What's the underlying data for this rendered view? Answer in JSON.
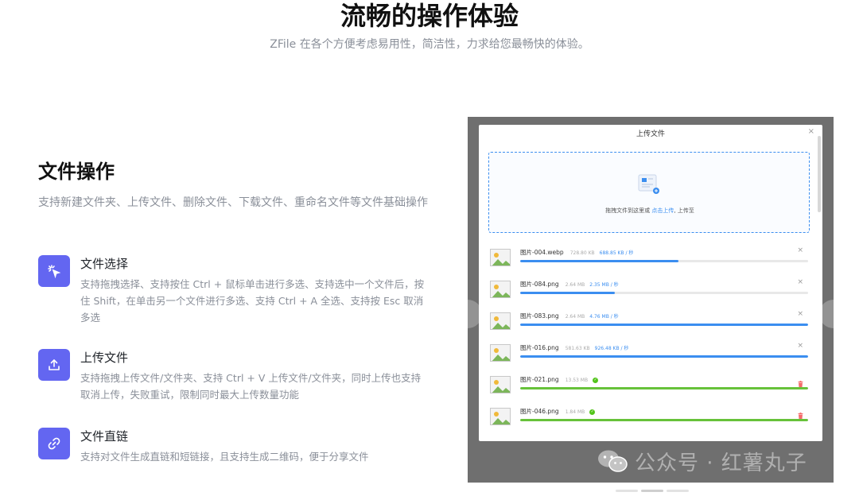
{
  "hero": {
    "title": "流畅的操作体验",
    "subtitle": "ZFile 在各个方便考虑易用性，简洁性，力求给您最畅快的体验。"
  },
  "section": {
    "title": "文件操作",
    "description": "支持新建文件夹、上传文件、删除文件、下载文件、重命名文件等文件基础操作"
  },
  "features": [
    {
      "icon": "cursor-click-icon",
      "title": "文件选择",
      "description": "支持拖拽选择、支持按住 Ctrl + 鼠标单击进行多选、支持选中一个文件后，按住 Shift，在单击另一个文件进行多选、支持 Ctrl + A 全选、支持按 Esc 取消多选"
    },
    {
      "icon": "upload-icon",
      "title": "上传文件",
      "description": "支持拖拽上传文件/文件夹、支持 Ctrl + V 上传文件/文件夹，同时上传也支持取消上传，失败重试，限制同时最大上传数量功能"
    },
    {
      "icon": "link-icon",
      "title": "文件直链",
      "description": "支持对文件生成直链和短链接，且支持生成二维码，便于分享文件"
    }
  ],
  "dialog": {
    "title": "上传文件",
    "close": "×",
    "dropzone_text": "拖拽文件到这里或 ",
    "dropzone_link": "点击上传",
    "dropzone_suffix": ", 上传至"
  },
  "files": [
    {
      "name": "图片-004.webp",
      "size": "728.80 KB",
      "speed": "688.85 KB / 秒",
      "progress": 0.55,
      "status": "uploading"
    },
    {
      "name": "图片-084.png",
      "size": "2.64 MB",
      "speed": "2.35 MB / 秒",
      "progress": 0.33,
      "status": "uploading"
    },
    {
      "name": "图片-083.png",
      "size": "2.64 MB",
      "speed": "4.76 MB / 秒",
      "progress": 1.0,
      "status": "uploading"
    },
    {
      "name": "图片-016.png",
      "size": "581.63 KB",
      "speed": "926.48 KB / 秒",
      "progress": 1.0,
      "status": "uploading"
    },
    {
      "name": "图片-021.png",
      "size": "13.53 MB",
      "speed": "",
      "progress": 1.0,
      "status": "done"
    },
    {
      "name": "图片-046.png",
      "size": "1.84 MB",
      "speed": "",
      "progress": 1.0,
      "status": "done"
    }
  ],
  "watermark": {
    "text": "公众号 · 红薯丸子"
  },
  "colors": {
    "accent": "#6366f1",
    "progress_blue": "#3b8ef0",
    "progress_green": "#67c23a"
  }
}
